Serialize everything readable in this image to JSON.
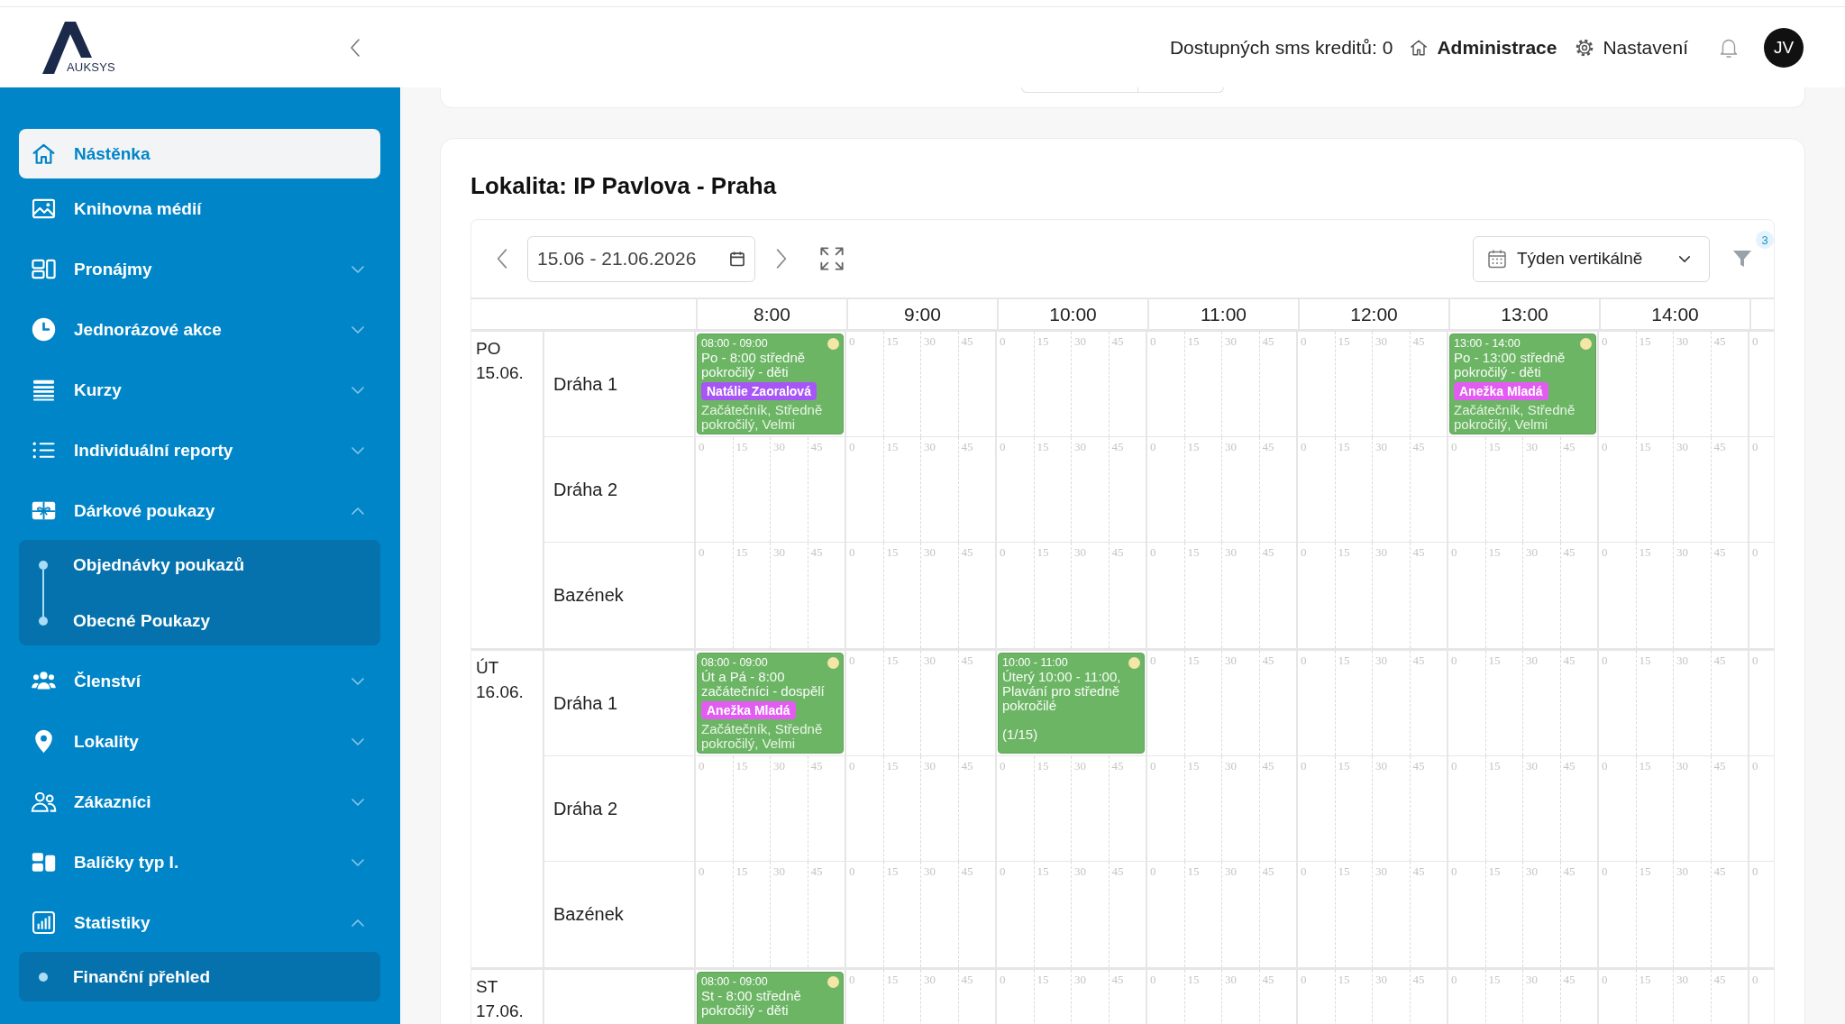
{
  "header": {
    "logo": "AUKSYS",
    "sms_credits": "Dostupných sms kreditů: 0",
    "links": [
      {
        "label": "Administrace",
        "selected": true
      },
      {
        "label": "Nastavení",
        "selected": false
      }
    ],
    "avatar": "JV"
  },
  "sidebar": {
    "items": [
      {
        "label": "Nástěnka",
        "selected": true
      },
      {
        "label": "Knihovna médií",
        "selected": false
      },
      {
        "label": "Pronájmy",
        "selected": false,
        "expanded": false
      },
      {
        "label": "Jednorázové akce",
        "selected": false,
        "expanded": false
      },
      {
        "label": "Kurzy",
        "selected": false,
        "expanded": false
      },
      {
        "label": "Individuální reporty",
        "selected": false,
        "expanded": false
      },
      {
        "label": "Dárkové poukazy",
        "selected": false,
        "expanded": true,
        "children": [
          {
            "label": "Objednávky poukazů",
            "selected": false
          },
          {
            "label": "Obecné Poukazy",
            "selected": false
          }
        ]
      },
      {
        "label": "Členství",
        "selected": false,
        "expanded": false
      },
      {
        "label": "Lokality",
        "selected": false,
        "expanded": false
      },
      {
        "label": "Zákazníci",
        "selected": false,
        "expanded": false
      },
      {
        "label": "Balíčky typ I.",
        "selected": false,
        "expanded": false
      },
      {
        "label": "Statistiky",
        "selected": false,
        "expanded": true,
        "children": [
          {
            "label": "Finanční přehled",
            "selected": false
          }
        ]
      }
    ]
  },
  "location": {
    "title": "Lokalita: IP Pavlova - Praha",
    "toolbar": {
      "date_range": "15.06 - 21.06.2026",
      "view": "Týden vertikálně",
      "filter_count": "3"
    },
    "hours": [
      "8:00",
      "9:00",
      "10:00",
      "11:00",
      "12:00",
      "13:00",
      "14:00"
    ],
    "days": [
      {
        "weekday": "PO",
        "date": "15.06.",
        "lanes": [
          {
            "name": "Dráha 1",
            "slots": [
              {
                "event": {
                  "time": "08:00 - 09:00",
                  "title": "Po - 8:00 středně pokročilý - děti",
                  "instructor": {
                    "name": "Natálie Zaoralová",
                    "color": "#a855f7"
                  },
                  "levels": "Začátečník, Středně pokročilý, Velmi"
                }
              },
              {
                "marks": [
                  "0",
                  "15",
                  "30",
                  "45"
                ]
              },
              {
                "marks": [
                  "0",
                  "15",
                  "30",
                  "45"
                ]
              },
              {
                "marks": [
                  "0",
                  "15",
                  "30",
                  "45"
                ]
              },
              {
                "marks": [
                  "0",
                  "15",
                  "30",
                  "45"
                ]
              },
              {
                "event": {
                  "time": "13:00 - 14:00",
                  "title": "Po - 13:00 středně pokročilý - děti",
                  "instructor": {
                    "name": "Anežka Mladá",
                    "color": "#e25cf2"
                  },
                  "levels": "Začátečník, Středně pokročilý, Velmi"
                }
              },
              {
                "marks": [
                  "0",
                  "15",
                  "30",
                  "45"
                ]
              },
              {
                "marks": [
                  "0"
                ]
              }
            ]
          },
          {
            "name": "Dráha 2",
            "slots": [
              {
                "marks": [
                  "0",
                  "15",
                  "30",
                  "45"
                ]
              },
              {
                "marks": [
                  "0",
                  "15",
                  "30",
                  "45"
                ]
              },
              {
                "marks": [
                  "0",
                  "15",
                  "30",
                  "45"
                ]
              },
              {
                "marks": [
                  "0",
                  "15",
                  "30",
                  "45"
                ]
              },
              {
                "marks": [
                  "0",
                  "15",
                  "30",
                  "45"
                ]
              },
              {
                "marks": [
                  "0",
                  "15",
                  "30",
                  "45"
                ]
              },
              {
                "marks": [
                  "0",
                  "15",
                  "30",
                  "45"
                ]
              },
              {
                "marks": [
                  "0"
                ]
              }
            ]
          },
          {
            "name": "Bazének",
            "slots": [
              {
                "marks": [
                  "0",
                  "15",
                  "30",
                  "45"
                ]
              },
              {
                "marks": [
                  "0",
                  "15",
                  "30",
                  "45"
                ]
              },
              {
                "marks": [
                  "0",
                  "15",
                  "30",
                  "45"
                ]
              },
              {
                "marks": [
                  "0",
                  "15",
                  "30",
                  "45"
                ]
              },
              {
                "marks": [
                  "0",
                  "15",
                  "30",
                  "45"
                ]
              },
              {
                "marks": [
                  "0",
                  "15",
                  "30",
                  "45"
                ]
              },
              {
                "marks": [
                  "0",
                  "15",
                  "30",
                  "45"
                ]
              },
              {
                "marks": [
                  "0"
                ]
              }
            ]
          }
        ]
      },
      {
        "weekday": "ÚT",
        "date": "16.06.",
        "lanes": [
          {
            "name": "Dráha 1",
            "slots": [
              {
                "event": {
                  "time": "08:00 - 09:00",
                  "title": "Út a Pá - 8:00 začátečníci - dospělí",
                  "instructor": {
                    "name": "Anežka Mladá",
                    "color": "#e25cf2"
                  },
                  "levels": "Začátečník, Středně pokročilý, Velmi"
                }
              },
              {
                "marks": [
                  "0",
                  "15",
                  "30",
                  "45"
                ]
              },
              {
                "event": {
                  "time": "10:00 - 11:00",
                  "title": "Úterý 10:00 - 11:00, Plavání pro středně pokročilé",
                  "capacity": "(1/15)"
                }
              },
              {
                "marks": [
                  "0",
                  "15",
                  "30",
                  "45"
                ]
              },
              {
                "marks": [
                  "0",
                  "15",
                  "30",
                  "45"
                ]
              },
              {
                "marks": [
                  "0",
                  "15",
                  "30",
                  "45"
                ]
              },
              {
                "marks": [
                  "0",
                  "15",
                  "30",
                  "45"
                ]
              },
              {
                "marks": [
                  "0"
                ]
              }
            ]
          },
          {
            "name": "Dráha 2",
            "slots": [
              {
                "marks": [
                  "0",
                  "15",
                  "30",
                  "45"
                ]
              },
              {
                "marks": [
                  "0",
                  "15",
                  "30",
                  "45"
                ]
              },
              {
                "marks": [
                  "0",
                  "15",
                  "30",
                  "45"
                ]
              },
              {
                "marks": [
                  "0",
                  "15",
                  "30",
                  "45"
                ]
              },
              {
                "marks": [
                  "0",
                  "15",
                  "30",
                  "45"
                ]
              },
              {
                "marks": [
                  "0",
                  "15",
                  "30",
                  "45"
                ]
              },
              {
                "marks": [
                  "0",
                  "15",
                  "30",
                  "45"
                ]
              },
              {
                "marks": [
                  "0"
                ]
              }
            ]
          },
          {
            "name": "Bazének",
            "slots": [
              {
                "marks": [
                  "0",
                  "15",
                  "30",
                  "45"
                ]
              },
              {
                "marks": [
                  "0",
                  "15",
                  "30",
                  "45"
                ]
              },
              {
                "marks": [
                  "0",
                  "15",
                  "30",
                  "45"
                ]
              },
              {
                "marks": [
                  "0",
                  "15",
                  "30",
                  "45"
                ]
              },
              {
                "marks": [
                  "0",
                  "15",
                  "30",
                  "45"
                ]
              },
              {
                "marks": [
                  "0",
                  "15",
                  "30",
                  "45"
                ]
              },
              {
                "marks": [
                  "0",
                  "15",
                  "30",
                  "45"
                ]
              },
              {
                "marks": [
                  "0"
                ]
              }
            ]
          }
        ]
      },
      {
        "weekday": "ST",
        "date": "17.06.",
        "lanes": [
          {
            "slots": [
              {
                "event": {
                  "time": "08:00 - 09:00",
                  "title": "St - 8:00 středně pokročilý - děti"
                }
              },
              {
                "marks": [
                  "0",
                  "15",
                  "30",
                  "45"
                ]
              },
              {
                "marks": [
                  "0",
                  "15",
                  "30",
                  "45"
                ]
              },
              {
                "marks": [
                  "0",
                  "15",
                  "30",
                  "45"
                ]
              },
              {
                "marks": [
                  "0",
                  "15",
                  "30",
                  "45"
                ]
              },
              {
                "marks": [
                  "0",
                  "15",
                  "30",
                  "45"
                ]
              },
              {
                "marks": [
                  "0",
                  "15",
                  "30",
                  "45"
                ]
              },
              {
                "marks": [
                  "0"
                ]
              }
            ]
          }
        ]
      }
    ]
  }
}
